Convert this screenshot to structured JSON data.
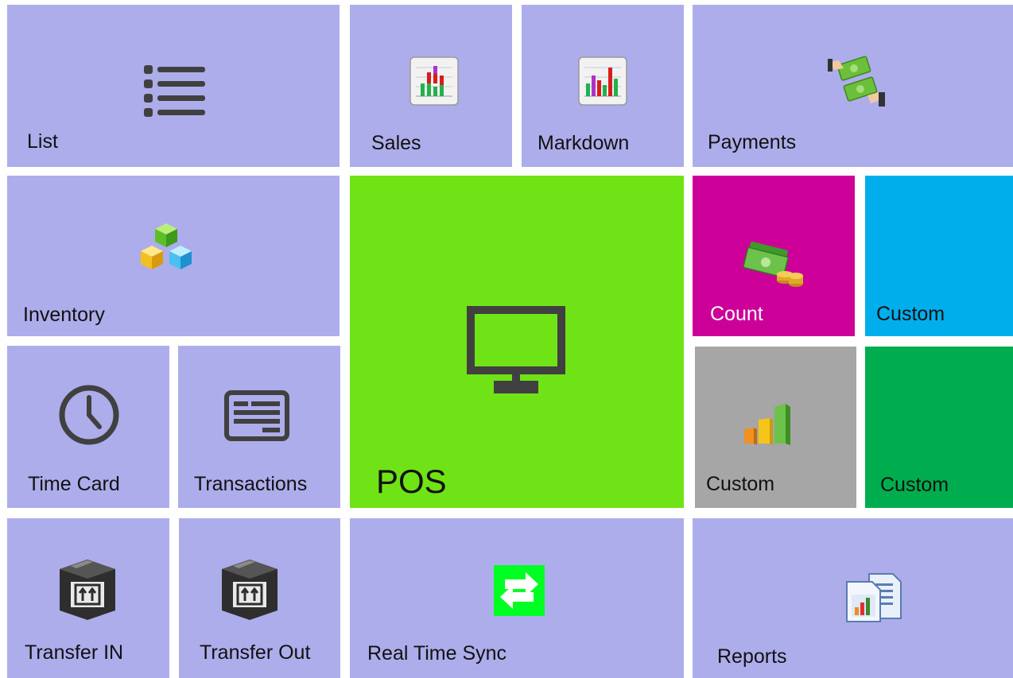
{
  "colors": {
    "tile_default": "#adadeb",
    "pos": "#6fe315",
    "count": "#cc0099",
    "custom_blue": "#00aeec",
    "custom_gray": "#a6a6a6",
    "custom_green": "#00ad4e",
    "icon_dark": "#404040"
  },
  "tiles": {
    "list": {
      "label": "List",
      "icon": "list-icon"
    },
    "sales": {
      "label": "Sales",
      "icon": "bar-chart-icon"
    },
    "markdown": {
      "label": "Markdown",
      "icon": "bar-chart-icon"
    },
    "payments": {
      "label": "Payments",
      "icon": "money-exchange-icon"
    },
    "inventory": {
      "label": "Inventory",
      "icon": "cubes-icon"
    },
    "pos": {
      "label": "POS",
      "icon": "monitor-icon"
    },
    "count": {
      "label": "Count",
      "icon": "cash-coins-icon"
    },
    "custom1": {
      "label": "Custom"
    },
    "time_card": {
      "label": "Time Card",
      "icon": "clock-icon"
    },
    "transactions": {
      "label": "Transactions",
      "icon": "receipt-icon"
    },
    "custom2": {
      "label": "Custom",
      "icon": "growth-chart-icon"
    },
    "custom3": {
      "label": "Custom"
    },
    "transfer_in": {
      "label": "Transfer IN",
      "icon": "box-icon"
    },
    "transfer_out": {
      "label": "Transfer Out",
      "icon": "box-icon"
    },
    "real_time_sync": {
      "label": "Real Time Sync",
      "icon": "sync-icon"
    },
    "reports": {
      "label": "Reports",
      "icon": "reports-icon"
    }
  }
}
